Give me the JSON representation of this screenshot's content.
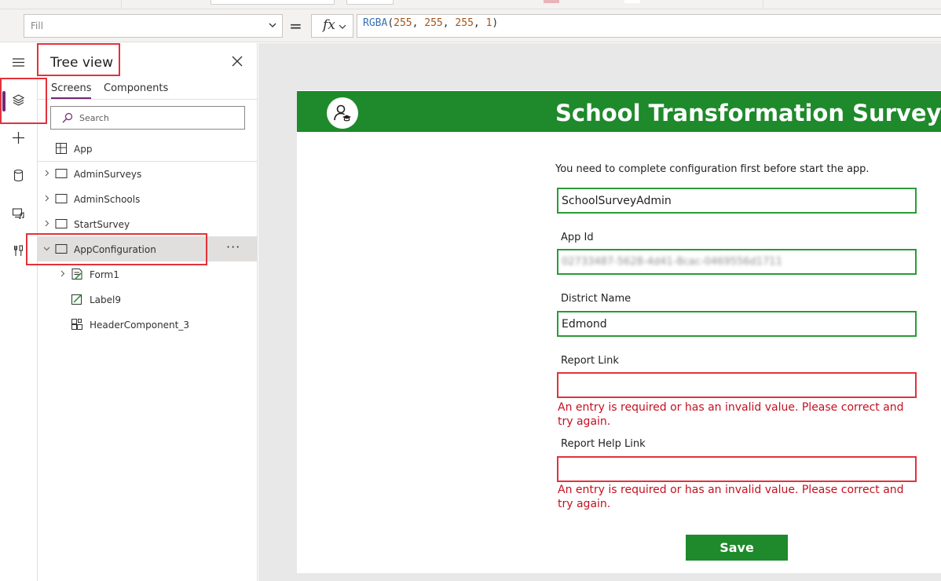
{
  "formula_bar": {
    "property": "Fill",
    "fx_label": "fx",
    "formula_fn": "RGBA",
    "formula_open": "(",
    "formula_args": [
      "255",
      "255",
      "255",
      "1"
    ],
    "formula_sep": ", ",
    "formula_close": ")",
    "equals": "="
  },
  "tree_view": {
    "title": "Tree view",
    "tabs": [
      "Screens",
      "Components"
    ],
    "search_placeholder": "Search",
    "app_label": "App",
    "screens": [
      {
        "label": "AdminSurveys"
      },
      {
        "label": "AdminSchools"
      },
      {
        "label": "StartSurvey"
      },
      {
        "label": "AppConfiguration",
        "selected": true
      }
    ],
    "children": [
      {
        "label": "Form1",
        "icon": "form-icon"
      },
      {
        "label": "Label9",
        "icon": "label-edit-icon"
      },
      {
        "label": "HeaderComponent_3",
        "icon": "component-icon"
      }
    ],
    "more_label": "···"
  },
  "rail": {
    "icons": [
      "hamburger-menu-icon",
      "layers-icon",
      "plus-icon",
      "data-cylinder-icon",
      "media-icon",
      "tools-icon"
    ]
  },
  "app_screen": {
    "header_title": "School Transformation Survey",
    "intro_text": "You need to complete configuration first before start the app.",
    "fields": [
      {
        "label": "",
        "value": "SchoolSurveyAdmin",
        "state": "valid"
      },
      {
        "label": "App Id",
        "value": "02733487-5628-4d41-8cac-0469556d1711",
        "state": "valid"
      },
      {
        "label": "District Name",
        "value": "Edmond",
        "state": "valid"
      },
      {
        "label": "Report Link",
        "value": "",
        "state": "error"
      },
      {
        "label": "Report Help Link",
        "value": "",
        "state": "error"
      }
    ],
    "error_message": "An entry is required or has an invalid value. Please correct and try again.",
    "save_label": "Save"
  },
  "colors": {
    "brand_green": "#1e8a2b",
    "accent_purple": "#742774",
    "error_red": "#c4101f",
    "highlight_red": "#e2323b"
  }
}
